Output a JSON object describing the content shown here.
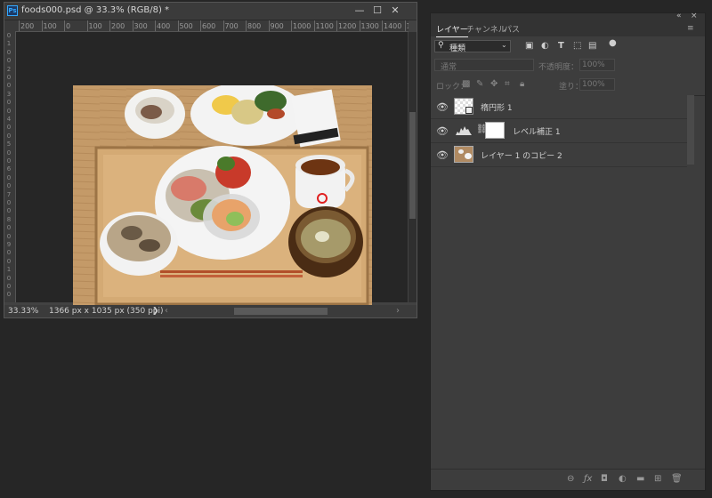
{
  "document": {
    "app_icon": "Ps",
    "title": "foods000.psd @ 33.3% (RGB/8) *",
    "window_buttons": [
      "—",
      "☐",
      "✕"
    ],
    "ruler_top": [
      "200",
      "100",
      "0",
      "100",
      "200",
      "300",
      "400",
      "500",
      "600",
      "700",
      "800",
      "900",
      "1000",
      "1100",
      "1200",
      "1300",
      "1400",
      "1500"
    ],
    "ruler_left": [
      "0",
      "1",
      "0",
      "0",
      "2",
      "0",
      "0",
      "3",
      "0",
      "0",
      "4",
      "0",
      "0",
      "5",
      "0",
      "0",
      "6",
      "0",
      "0",
      "7",
      "0",
      "0",
      "8",
      "0",
      "0",
      "9",
      "0",
      "0",
      "1",
      "0",
      "0",
      "0"
    ],
    "zoom": "33.33%",
    "doc_info": "1366 px x 1035 px (350 ppi)",
    "status_arrow": "❯",
    "scroll_left": "‹",
    "scroll_right": "›"
  },
  "panel": {
    "collapse": "«",
    "close": "×",
    "tabs": [
      "レイヤー",
      "チャンネル",
      "パス"
    ],
    "menu": "≡",
    "filter": {
      "icon": "search-icon",
      "value": "種類"
    },
    "blend_mode": "通常",
    "opacity_label": "不透明度：",
    "opacity_value": "100%",
    "lock_label": "ロック：",
    "fill_label": "塗り：",
    "fill_value": "100%",
    "layers": [
      {
        "name": "楕円形 1",
        "type": "shape"
      },
      {
        "name": "レベル補正 1",
        "type": "adjustment"
      },
      {
        "name": "レイヤー 1 のコピー 2",
        "type": "pixel"
      }
    ]
  }
}
